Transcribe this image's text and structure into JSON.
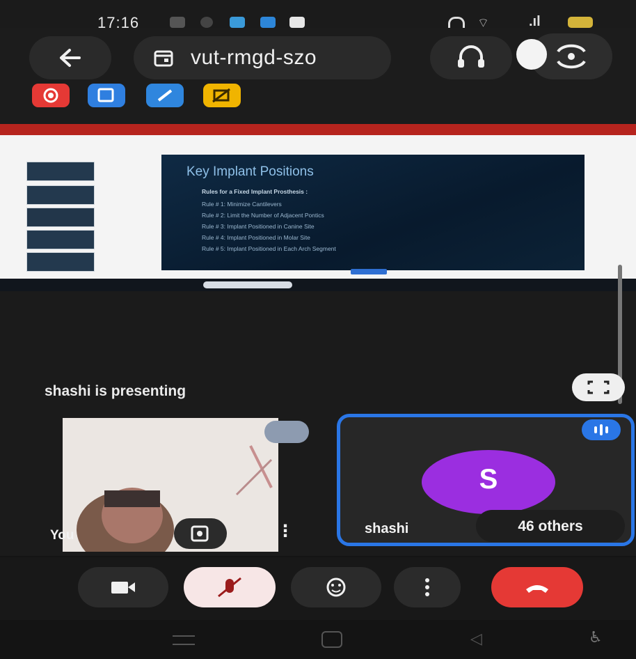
{
  "status_bar": {
    "time": "17:16",
    "icons": [
      "camera-icon",
      "chat-icon",
      "app-icon",
      "app-icon",
      "app-icon",
      "headset-icon",
      "wifi-icon",
      "signal-icon",
      "battery-icon"
    ]
  },
  "meeting": {
    "code": "vut-rmgd-szo"
  },
  "top_actions": [
    "record-icon",
    "whiteboard-icon",
    "edit-icon",
    "no-camera-icon"
  ],
  "slide": {
    "title": "Key Implant Positions",
    "subtitle": "Rules for a Fixed Implant Prosthesis :",
    "rules": [
      "Rule # 1: Minimize Cantilevers",
      "Rule # 2: Limit the Number of Adjacent Pontics",
      "Rule # 3: Implant Positioned in Canine Site",
      "Rule # 4: Implant Positioned in Molar Site",
      "Rule # 5: Implant Positioned in Each Arch Segment"
    ]
  },
  "presentation": {
    "status": "shashi is presenting"
  },
  "participants": {
    "self_label": "You",
    "presenter_name": "shashi",
    "presenter_initial": "S",
    "others_label": "46 others"
  },
  "colors": {
    "accent": "#2a76e6",
    "end_call": "#e53935",
    "avatar": "#9b2ee0"
  }
}
